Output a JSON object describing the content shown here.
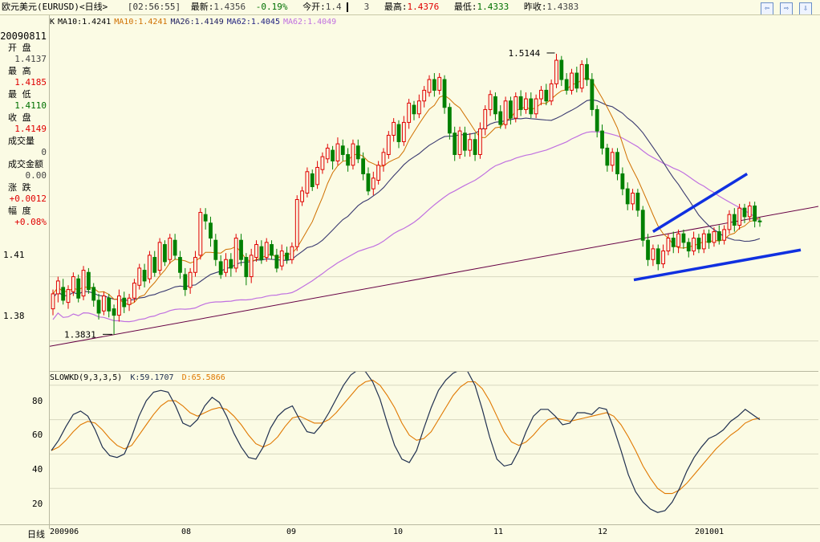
{
  "header": {
    "instrument": "欧元美元(EURUSD)<日线>",
    "time": "[02:56:55]",
    "latest_label": "最新:",
    "latest": "1.4356",
    "change": "-0.19%",
    "open_label": "今开:",
    "open": "1.4",
    "open_tail": "3",
    "high_label": "最高:",
    "high": "1.4376",
    "low_label": "最低:",
    "low": "1.4333",
    "prev_label": "昨收:",
    "prev": "1.4383",
    "nav": [
      "⇦",
      "⇨",
      "⇩"
    ]
  },
  "panel": {
    "date": "20090811",
    "rows": [
      {
        "label": "开 盘",
        "value": "1.4137",
        "color": "#444444"
      },
      {
        "label": "最 高",
        "value": "1.4185",
        "color": "#e00000"
      },
      {
        "label": "最 低",
        "value": "1.4110",
        "color": "#007000"
      },
      {
        "label": "收 盘",
        "value": "1.4149",
        "color": "#e00000"
      },
      {
        "label": "成交量",
        "value": "0",
        "color": "#444444"
      },
      {
        "label": "成交金额",
        "value": "0.00",
        "color": "#444444"
      },
      {
        "label": "涨 跌",
        "value": "+0.0012",
        "color": "#e00000"
      },
      {
        "label": "幅 度",
        "value": "+0.08%",
        "color": "#e00000"
      }
    ]
  },
  "ma_legend": [
    {
      "text": "K",
      "color": "#000000"
    },
    {
      "text": "MA10:1.4241",
      "color": "#000000"
    },
    {
      "text": "MA10:1.4241",
      "color": "#d07000"
    },
    {
      "text": "MA26:1.4149",
      "color": "#202060"
    },
    {
      "text": "MA62:1.4045",
      "color": "#202080"
    },
    {
      "text": "MA62:1.4049",
      "color": "#c070e0"
    }
  ],
  "kd_legend": {
    "name": "SLOWKD(9,3,3,5)",
    "k": "K:59.1707",
    "d": "D:65.5866",
    "k_color": "#203050",
    "d_color": "#e07800"
  },
  "bottom": {
    "period": "日线"
  },
  "colors": {
    "up": "#e00000",
    "down": "#008000",
    "ma_fast": "#d07000",
    "ma_mid": "#3a3a70",
    "ma_slow": "#c070e0",
    "trend": "#660044",
    "drawn": "#1030e0",
    "grid": "#d8d8c0"
  },
  "chart_data": {
    "type": "candlestick",
    "period": "daily",
    "y_ticks": [
      1.41,
      1.38
    ],
    "price_range": [
      1.366,
      1.532
    ],
    "annotations": [
      {
        "text": "1.5144",
        "value": 1.5144
      },
      {
        "text": "1.3831",
        "value": 1.3831
      }
    ],
    "x_labels": [
      "200906",
      "08",
      "09",
      "10",
      "11",
      "12",
      "201001"
    ],
    "candles": [
      [
        1.395,
        1.402,
        1.392,
        1.404
      ],
      [
        1.402,
        1.408,
        1.398,
        1.41
      ],
      [
        1.405,
        1.399,
        1.397,
        1.409
      ],
      [
        1.398,
        1.404,
        1.395,
        1.406
      ],
      [
        1.403,
        1.41,
        1.401,
        1.412
      ],
      [
        1.409,
        1.4,
        1.398,
        1.411
      ],
      [
        1.401,
        1.413,
        1.399,
        1.415
      ],
      [
        1.412,
        1.404,
        1.402,
        1.414
      ],
      [
        1.405,
        1.399,
        1.396,
        1.407
      ],
      [
        1.399,
        1.393,
        1.39,
        1.402
      ],
      [
        1.394,
        1.401,
        1.392,
        1.403
      ],
      [
        1.4,
        1.394,
        1.391,
        1.402
      ],
      [
        1.395,
        1.392,
        1.383,
        1.397
      ],
      [
        1.392,
        1.401,
        1.389,
        1.404
      ],
      [
        1.4,
        1.396,
        1.393,
        1.403
      ],
      [
        1.397,
        1.4,
        1.394,
        1.402
      ],
      [
        1.4,
        1.407,
        1.398,
        1.409
      ],
      [
        1.406,
        1.414,
        1.404,
        1.416
      ],
      [
        1.413,
        1.408,
        1.405,
        1.416
      ],
      [
        1.409,
        1.42,
        1.407,
        1.422
      ],
      [
        1.419,
        1.412,
        1.41,
        1.422
      ],
      [
        1.413,
        1.426,
        1.411,
        1.428
      ],
      [
        1.425,
        1.417,
        1.415,
        1.427
      ],
      [
        1.418,
        1.428,
        1.416,
        1.43
      ],
      [
        1.427,
        1.42,
        1.418,
        1.43
      ],
      [
        1.419,
        1.412,
        1.409,
        1.422
      ],
      [
        1.411,
        1.404,
        1.401,
        1.414
      ],
      [
        1.405,
        1.412,
        1.402,
        1.414
      ],
      [
        1.412,
        1.419,
        1.41,
        1.422
      ],
      [
        1.42,
        1.44,
        1.418,
        1.442
      ],
      [
        1.439,
        1.436,
        1.432,
        1.442
      ],
      [
        1.435,
        1.428,
        1.424,
        1.438
      ],
      [
        1.427,
        1.418,
        1.415,
        1.43
      ],
      [
        1.417,
        1.411,
        1.409,
        1.42
      ],
      [
        1.412,
        1.418,
        1.41,
        1.421
      ],
      [
        1.418,
        1.414,
        1.41,
        1.421
      ],
      [
        1.414,
        1.428,
        1.412,
        1.43
      ],
      [
        1.427,
        1.418,
        1.415,
        1.43
      ],
      [
        1.419,
        1.41,
        1.406,
        1.421
      ],
      [
        1.41,
        1.42,
        1.407,
        1.423
      ],
      [
        1.419,
        1.425,
        1.417,
        1.427
      ],
      [
        1.424,
        1.418,
        1.416,
        1.427
      ],
      [
        1.419,
        1.426,
        1.417,
        1.428
      ],
      [
        1.425,
        1.42,
        1.418,
        1.427
      ],
      [
        1.42,
        1.414,
        1.412,
        1.423
      ],
      [
        1.415,
        1.422,
        1.413,
        1.425
      ],
      [
        1.421,
        1.418,
        1.416,
        1.424
      ],
      [
        1.418,
        1.424,
        1.416,
        1.426
      ],
      [
        1.424,
        1.446,
        1.422,
        1.448
      ],
      [
        1.445,
        1.45,
        1.443,
        1.452
      ],
      [
        1.449,
        1.459,
        1.447,
        1.461
      ],
      [
        1.458,
        1.452,
        1.45,
        1.46
      ],
      [
        1.453,
        1.461,
        1.451,
        1.464
      ],
      [
        1.46,
        1.466,
        1.458,
        1.468
      ],
      [
        1.465,
        1.47,
        1.463,
        1.472
      ],
      [
        1.469,
        1.464,
        1.46,
        1.471
      ],
      [
        1.464,
        1.472,
        1.462,
        1.475
      ],
      [
        1.471,
        1.467,
        1.464,
        1.474
      ],
      [
        1.467,
        1.462,
        1.459,
        1.47
      ],
      [
        1.462,
        1.472,
        1.46,
        1.474
      ],
      [
        1.471,
        1.465,
        1.463,
        1.474
      ],
      [
        1.465,
        1.458,
        1.455,
        1.468
      ],
      [
        1.458,
        1.45,
        1.448,
        1.461
      ],
      [
        1.451,
        1.456,
        1.448,
        1.459
      ],
      [
        1.455,
        1.462,
        1.453,
        1.464
      ],
      [
        1.462,
        1.468,
        1.459,
        1.47
      ],
      [
        1.467,
        1.476,
        1.465,
        1.478
      ],
      [
        1.476,
        1.482,
        1.473,
        1.484
      ],
      [
        1.481,
        1.473,
        1.47,
        1.483
      ],
      [
        1.473,
        1.482,
        1.471,
        1.485
      ],
      [
        1.482,
        1.491,
        1.479,
        1.493
      ],
      [
        1.49,
        1.486,
        1.483,
        1.492
      ],
      [
        1.486,
        1.492,
        1.484,
        1.495
      ],
      [
        1.492,
        1.497,
        1.489,
        1.499
      ],
      [
        1.496,
        1.502,
        1.494,
        1.504
      ],
      [
        1.502,
        1.497,
        1.494,
        1.505
      ],
      [
        1.497,
        1.503,
        1.495,
        1.505
      ],
      [
        1.502,
        1.489,
        1.486,
        1.504
      ],
      [
        1.489,
        1.477,
        1.474,
        1.491
      ],
      [
        1.477,
        1.467,
        1.464,
        1.48
      ],
      [
        1.467,
        1.478,
        1.465,
        1.48
      ],
      [
        1.477,
        1.469,
        1.466,
        1.48
      ],
      [
        1.469,
        1.474,
        1.466,
        1.477
      ],
      [
        1.474,
        1.467,
        1.464,
        1.477
      ],
      [
        1.467,
        1.479,
        1.465,
        1.482
      ],
      [
        1.479,
        1.488,
        1.476,
        1.49
      ],
      [
        1.488,
        1.495,
        1.485,
        1.497
      ],
      [
        1.494,
        1.486,
        1.483,
        1.496
      ],
      [
        1.487,
        1.481,
        1.479,
        1.49
      ],
      [
        1.481,
        1.492,
        1.479,
        1.494
      ],
      [
        1.492,
        1.484,
        1.481,
        1.494
      ],
      [
        1.484,
        1.494,
        1.482,
        1.496
      ],
      [
        1.494,
        1.488,
        1.485,
        1.497
      ],
      [
        1.488,
        1.493,
        1.486,
        1.496
      ],
      [
        1.493,
        1.486,
        1.484,
        1.496
      ],
      [
        1.486,
        1.493,
        1.484,
        1.495
      ],
      [
        1.493,
        1.497,
        1.49,
        1.499
      ],
      [
        1.497,
        1.492,
        1.49,
        1.5
      ],
      [
        1.492,
        1.5,
        1.49,
        1.502
      ],
      [
        1.5,
        1.511,
        1.498,
        1.514
      ],
      [
        1.511,
        1.502,
        1.499,
        1.513
      ],
      [
        1.502,
        1.497,
        1.495,
        1.505
      ],
      [
        1.497,
        1.505,
        1.495,
        1.507
      ],
      [
        1.505,
        1.498,
        1.496,
        1.508
      ],
      [
        1.498,
        1.509,
        1.496,
        1.511
      ],
      [
        1.509,
        1.502,
        1.499,
        1.512
      ],
      [
        1.502,
        1.488,
        1.485,
        1.505
      ],
      [
        1.488,
        1.478,
        1.475,
        1.49
      ],
      [
        1.478,
        1.47,
        1.467,
        1.481
      ],
      [
        1.47,
        1.462,
        1.459,
        1.472
      ],
      [
        1.462,
        1.468,
        1.459,
        1.47
      ],
      [
        1.468,
        1.458,
        1.455,
        1.47
      ],
      [
        1.458,
        1.451,
        1.448,
        1.461
      ],
      [
        1.451,
        1.444,
        1.441,
        1.454
      ],
      [
        1.444,
        1.449,
        1.441,
        1.451
      ],
      [
        1.449,
        1.441,
        1.438,
        1.451
      ],
      [
        1.441,
        1.427,
        1.424,
        1.443
      ],
      [
        1.427,
        1.418,
        1.415,
        1.43
      ],
      [
        1.418,
        1.423,
        1.415,
        1.425
      ],
      [
        1.423,
        1.416,
        1.413,
        1.425
      ],
      [
        1.416,
        1.422,
        1.414,
        1.425
      ],
      [
        1.422,
        1.428,
        1.42,
        1.43
      ],
      [
        1.428,
        1.424,
        1.421,
        1.431
      ],
      [
        1.424,
        1.43,
        1.421,
        1.432
      ],
      [
        1.43,
        1.426,
        1.423,
        1.432
      ],
      [
        1.426,
        1.422,
        1.419,
        1.428
      ],
      [
        1.422,
        1.428,
        1.42,
        1.431
      ],
      [
        1.428,
        1.423,
        1.421,
        1.43
      ],
      [
        1.423,
        1.43,
        1.421,
        1.432
      ],
      [
        1.43,
        1.426,
        1.423,
        1.432
      ],
      [
        1.426,
        1.431,
        1.424,
        1.433
      ],
      [
        1.431,
        1.427,
        1.425,
        1.434
      ],
      [
        1.427,
        1.432,
        1.425,
        1.434
      ],
      [
        1.432,
        1.439,
        1.43,
        1.441
      ],
      [
        1.439,
        1.434,
        1.431,
        1.442
      ],
      [
        1.434,
        1.442,
        1.432,
        1.444
      ],
      [
        1.442,
        1.438,
        1.435,
        1.444
      ],
      [
        1.438,
        1.443,
        1.436,
        1.445
      ],
      [
        1.443,
        1.436,
        1.433,
        1.445
      ],
      [
        1.436,
        1.4356,
        1.4333,
        1.4376
      ]
    ],
    "kd": {
      "ylim": [
        0,
        100
      ],
      "y_ticks": [
        80,
        60,
        40,
        20
      ],
      "k": [
        42,
        48,
        56,
        63,
        65,
        62,
        54,
        44,
        39,
        38,
        40,
        50,
        62,
        71,
        76,
        77,
        76,
        68,
        58,
        56,
        60,
        68,
        73,
        70,
        62,
        52,
        44,
        38,
        37,
        44,
        55,
        62,
        66,
        68,
        60,
        53,
        52,
        57,
        64,
        72,
        80,
        86,
        89,
        88,
        82,
        72,
        58,
        45,
        37,
        35,
        42,
        55,
        67,
        77,
        83,
        87,
        89,
        88,
        80,
        66,
        50,
        37,
        33,
        34,
        42,
        53,
        62,
        66,
        66,
        62,
        57,
        58,
        64,
        64,
        63,
        67,
        66,
        55,
        42,
        28,
        18,
        12,
        8,
        6,
        7,
        12,
        20,
        30,
        38,
        44,
        49,
        51,
        54,
        59,
        62,
        66,
        63,
        60
      ],
      "d": [
        42,
        44,
        48,
        53,
        57,
        59,
        58,
        54,
        49,
        45,
        43,
        45,
        51,
        57,
        63,
        68,
        71,
        71,
        68,
        64,
        62,
        64,
        66,
        67,
        66,
        62,
        57,
        51,
        46,
        44,
        46,
        50,
        56,
        61,
        62,
        60,
        58,
        58,
        60,
        64,
        69,
        74,
        79,
        82,
        83,
        80,
        74,
        67,
        58,
        51,
        48,
        49,
        53,
        60,
        67,
        74,
        79,
        82,
        82,
        78,
        71,
        62,
        53,
        47,
        45,
        47,
        51,
        56,
        60,
        61,
        60,
        59,
        60,
        61,
        62,
        63,
        64,
        62,
        57,
        50,
        42,
        33,
        26,
        20,
        17,
        17,
        19,
        23,
        28,
        33,
        38,
        43,
        47,
        51,
        54,
        58,
        60,
        61
      ]
    }
  }
}
